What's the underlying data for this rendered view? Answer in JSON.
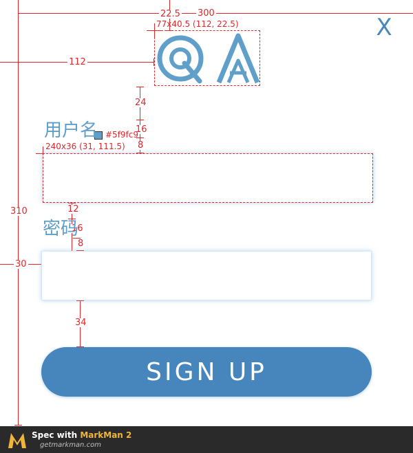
{
  "close_label": "X",
  "logo_text": "QA",
  "username": {
    "label": "用户名",
    "value": ""
  },
  "password": {
    "label": "密码",
    "value": ""
  },
  "signup_label": "SIGN UP",
  "colors": {
    "label": "#5f9fc9",
    "button": "#4686bc",
    "annotation": "#e3262a",
    "footer": "#2a2a2a"
  },
  "annotations": {
    "logo_offset_top": "22.5",
    "width_300": "300",
    "logo_spec": "77x40.5 (112, 22.5)",
    "left_112": "112",
    "gap_24": "24",
    "gap_16a": "16",
    "gap_8a": "8",
    "swatch_color": "#5f9fc9",
    "input_spec": "240x36 (31, 111.5)",
    "gap_12": "12",
    "gap_16b": "16",
    "gap_8b": "8",
    "height_310": "310",
    "left_30": "30",
    "gap_34": "34"
  },
  "footer": {
    "prefix": "Spec with ",
    "brand": "MarkMan 2",
    "url": "getmarkman.com"
  }
}
